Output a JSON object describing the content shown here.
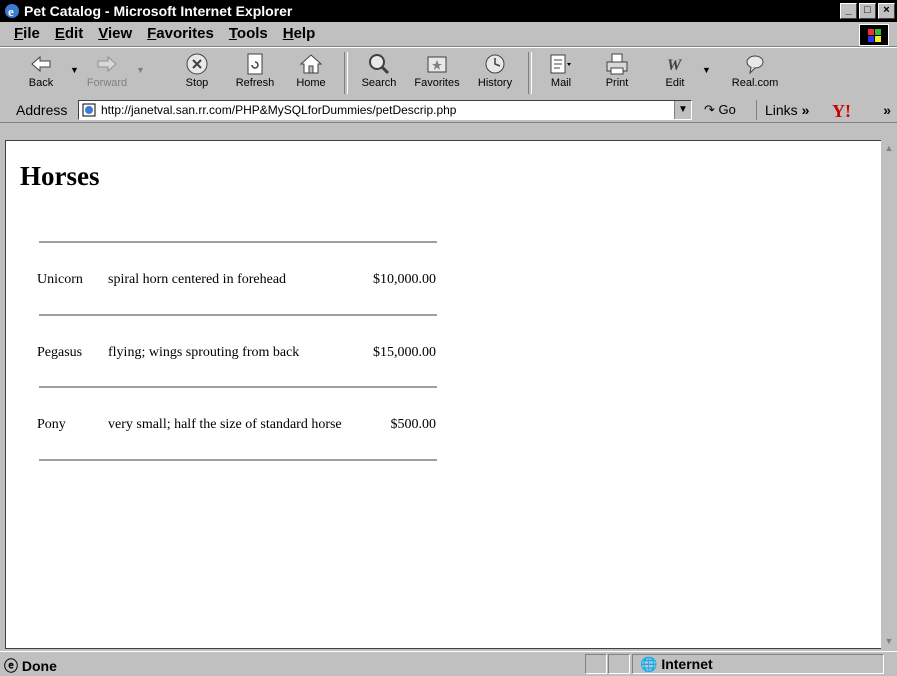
{
  "window": {
    "title": "Pet Catalog - Microsoft Internet Explorer",
    "buttons": {
      "minimize": "_",
      "maximize": "□",
      "close": "×"
    }
  },
  "menubar": {
    "items": [
      {
        "label": "File"
      },
      {
        "label": "Edit"
      },
      {
        "label": "View"
      },
      {
        "label": "Favorites"
      },
      {
        "label": "Tools"
      },
      {
        "label": "Help"
      }
    ]
  },
  "toolbar": {
    "buttons": [
      {
        "label": "Back",
        "icon": "back-arrow-icon"
      },
      {
        "label": "Forward",
        "icon": "forward-arrow-icon"
      },
      {
        "label": "Stop",
        "icon": "stop-icon"
      },
      {
        "label": "Refresh",
        "icon": "refresh-icon"
      },
      {
        "label": "Home",
        "icon": "home-icon"
      },
      {
        "label": "Search",
        "icon": "search-icon"
      },
      {
        "label": "Favorites",
        "icon": "favorites-icon"
      },
      {
        "label": "History",
        "icon": "history-icon"
      },
      {
        "label": "Mail",
        "icon": "mail-icon"
      },
      {
        "label": "Print",
        "icon": "print-icon"
      },
      {
        "label": "Edit",
        "icon": "edit-icon"
      },
      {
        "label": "Real.com",
        "icon": "realcom-icon"
      }
    ]
  },
  "addressbar": {
    "label": "Address",
    "url": "http://janetval.san.rr.com/PHP&MySQLforDummies/petDescrip.php",
    "go_label": "Go",
    "links_label": "Links",
    "more": "»"
  },
  "page": {
    "heading": "Horses",
    "rows": [
      {
        "name": "Unicorn",
        "description": "spiral horn centered in forehead",
        "price": "$10,000.00"
      },
      {
        "name": "Pegasus",
        "description": "flying; wings sprouting from back",
        "price": "$15,000.00"
      },
      {
        "name": "Pony",
        "description": "very small; half the size of standard horse",
        "price": "$500.00"
      }
    ]
  },
  "statusbar": {
    "status": "Done",
    "zone": "Internet"
  }
}
